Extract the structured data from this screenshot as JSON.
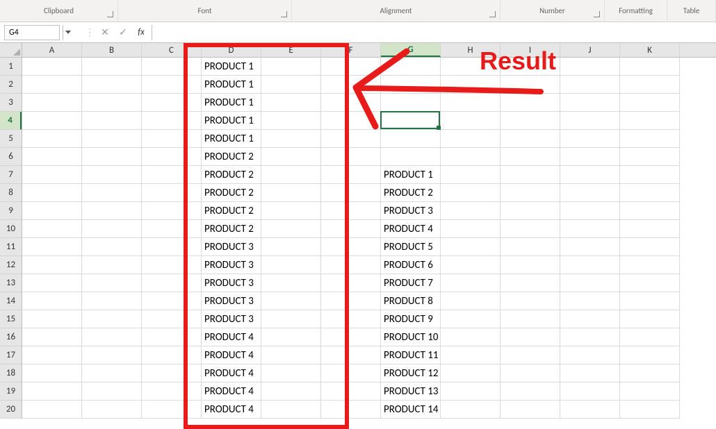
{
  "ribbon": {
    "groups": [
      "Clipboard",
      "Font",
      "Alignment",
      "Number",
      "Formatting",
      "Table"
    ]
  },
  "name_box": "G4",
  "columns": [
    "A",
    "B",
    "C",
    "D",
    "E",
    "F",
    "G",
    "H",
    "I",
    "J",
    "K"
  ],
  "rows": [
    "1",
    "2",
    "3",
    "4",
    "5",
    "6",
    "7",
    "8",
    "9",
    "10",
    "11",
    "12",
    "13",
    "14",
    "15",
    "16",
    "17",
    "18",
    "19",
    "20"
  ],
  "selected_row": "4",
  "selected_col": "G",
  "col_d": {
    "1": "PRODUCT 1",
    "2": "PRODUCT 1",
    "3": "PRODUCT 1",
    "4": "PRODUCT 1",
    "5": "PRODUCT 1",
    "6": "PRODUCT 2",
    "7": "PRODUCT 2",
    "8": "PRODUCT 2",
    "9": "PRODUCT 2",
    "10": "PRODUCT 2",
    "11": "PRODUCT 3",
    "12": "PRODUCT 3",
    "13": "PRODUCT 3",
    "14": "PRODUCT 3",
    "15": "PRODUCT 3",
    "16": "PRODUCT 4",
    "17": "PRODUCT 4",
    "18": "PRODUCT 4",
    "19": "PRODUCT 4",
    "20": "PRODUCT 4"
  },
  "col_g": {
    "7": "PRODUCT 1",
    "8": "PRODUCT 2",
    "9": "PRODUCT 3",
    "10": "PRODUCT 4",
    "11": "PRODUCT 5",
    "12": "PRODUCT 6",
    "13": "PRODUCT 7",
    "14": "PRODUCT 8",
    "15": "PRODUCT 9",
    "16": "PRODUCT 10",
    "17": "PRODUCT 11",
    "18": "PRODUCT 12",
    "19": "PRODUCT 13",
    "20": "PRODUCT 14"
  },
  "annotation": {
    "result_label": "Result"
  }
}
